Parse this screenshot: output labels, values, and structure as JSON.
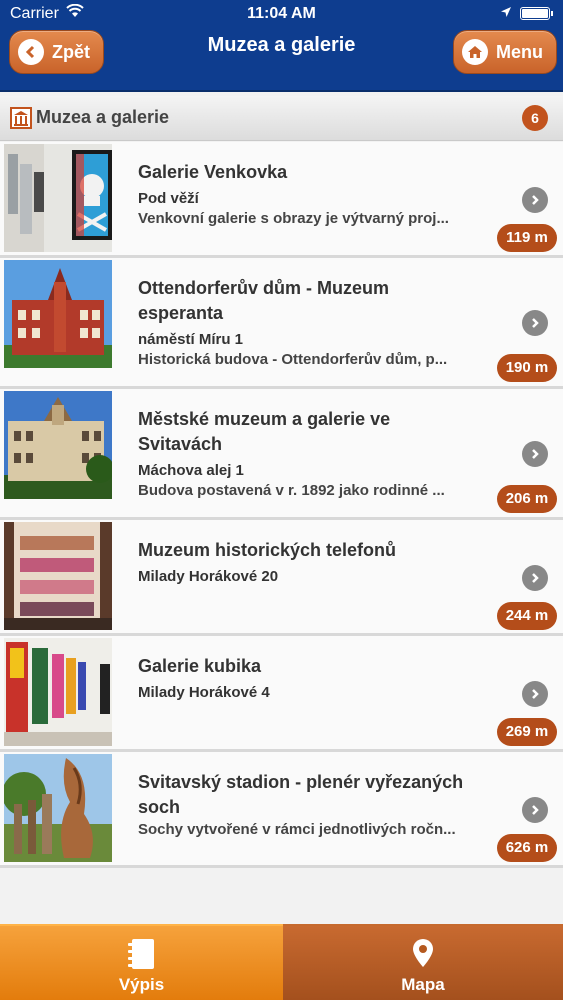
{
  "status": {
    "carrier": "Carrier",
    "time": "11:04 AM"
  },
  "nav": {
    "title": "Muzea a galerie",
    "back_label": "Zpět",
    "menu_label": "Menu"
  },
  "section": {
    "title": "Muzea a galerie",
    "count": "6"
  },
  "items": [
    {
      "name": "Galerie Venkovka",
      "address": "Pod věží",
      "description": "Venkovní galerie s obrazy je výtvarný proj...",
      "distance": "119 m"
    },
    {
      "name": "Ottendorferův dům - Muzeum esperanta",
      "address": "náměstí Míru 1",
      "description": "Historická budova - Ottendorferův dům, p...",
      "distance": "190 m"
    },
    {
      "name": "Městské muzeum a galerie ve Svitavách",
      "address": "Máchova alej 1",
      "description": "Budova postavená v r. 1892 jako rodinné ...",
      "distance": "206 m"
    },
    {
      "name": "Muzeum historických telefonů",
      "address": "Milady Horákové 20",
      "description": "",
      "distance": "244 m"
    },
    {
      "name": "Galerie kubika",
      "address": "Milady Horákové 4",
      "description": "",
      "distance": "269 m"
    },
    {
      "name": "Svitavský stadion - plenér vyřezaných soch",
      "address": "",
      "description": "Sochy vytvořené v rámci jednotlivých ročn...",
      "distance": "626 m"
    }
  ],
  "tabs": {
    "list_label": "Výpis",
    "map_label": "Mapa"
  },
  "colors": {
    "navbar": "#0e3d8f",
    "accent": "#c2531d",
    "tab_active": "#f29a2e"
  }
}
